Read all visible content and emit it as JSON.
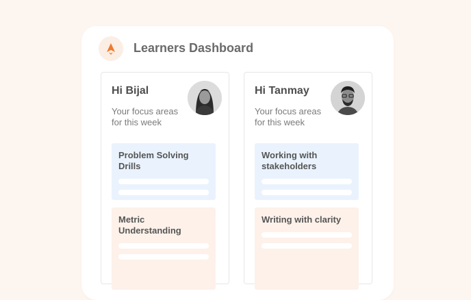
{
  "app": {
    "title": "Learners Dashboard",
    "logo_icon": "rocket-icon",
    "accent_color": "#f07b2c"
  },
  "learners": [
    {
      "greeting": "Hi Bijal",
      "subtitle": "Your focus areas for this week",
      "avatar_icon": "avatar-female",
      "focus_areas": [
        {
          "title": "Problem Solving Drills",
          "color": "#eaf3fd"
        },
        {
          "title": "Metric Understanding",
          "color": "#fdf1ea"
        }
      ]
    },
    {
      "greeting": "Hi Tanmay",
      "subtitle": "Your focus areas for this week",
      "avatar_icon": "avatar-male",
      "focus_areas": [
        {
          "title": "Working with stakeholders",
          "color": "#eaf3fd"
        },
        {
          "title": "Writing with clarity",
          "color": "#fdf1ea"
        }
      ]
    }
  ]
}
